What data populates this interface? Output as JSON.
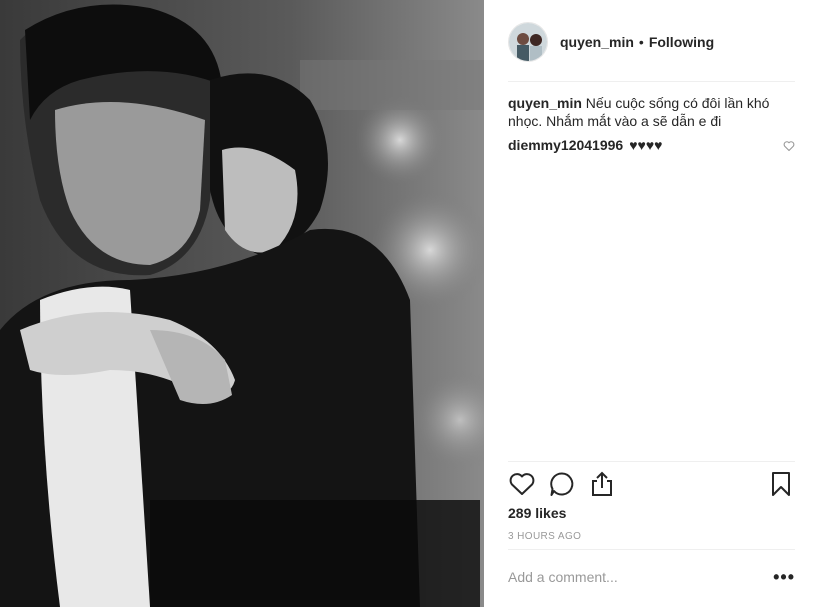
{
  "post": {
    "username": "quyen_min",
    "separator": "•",
    "follow_status": "Following",
    "caption_user": "quyen_min",
    "caption_text": "Nếu cuộc sống có đôi lần khó nhọc. Nhắm mắt vào a sẽ dẫn e đi",
    "comments": [
      {
        "user": "diemmy12041996",
        "text": "♥♥♥♥"
      }
    ],
    "likes": "289 likes",
    "timestamp": "3 HOURS AGO",
    "add_comment_placeholder": "Add a comment...",
    "more_options": "•••"
  },
  "icons": {
    "like": "heart-outline-icon",
    "comment": "speech-bubble-icon",
    "share": "share-upload-icon",
    "save": "bookmark-icon",
    "comment_like": "small-heart-icon"
  }
}
